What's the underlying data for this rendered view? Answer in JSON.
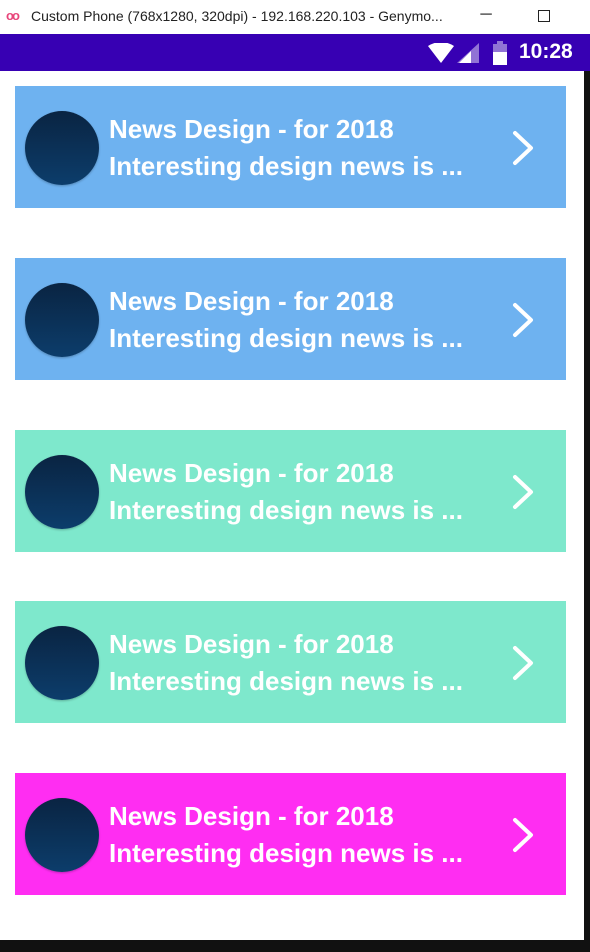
{
  "window": {
    "title": "Custom Phone (768x1280, 320dpi) - 192.168.220.103 - Genymo...",
    "logo": "oo",
    "minimize_glyph": "─"
  },
  "statusbar": {
    "time": "10:28",
    "color": "#3700b3"
  },
  "cards": [
    {
      "title": "News Design - for 2018",
      "subtitle": "Interesting design news is ...",
      "color": "#6eb2f0",
      "icon": "chevron-right-icon"
    },
    {
      "title": "News Design - for 2018",
      "subtitle": "Interesting design news is ...",
      "color": "#6eb2f0",
      "icon": "chevron-right-icon"
    },
    {
      "title": "News Design - for 2018",
      "subtitle": "Interesting design news is ...",
      "color": "#7ee8cc",
      "icon": "chevron-right-icon"
    },
    {
      "title": "News Design - for 2018",
      "subtitle": "Interesting design news is ...",
      "color": "#7ee8cc",
      "icon": "chevron-right-icon"
    },
    {
      "title": "News Design - for 2018",
      "subtitle": "Interesting design news is ...",
      "color": "#ff2df2",
      "icon": "chevron-right-icon"
    }
  ]
}
